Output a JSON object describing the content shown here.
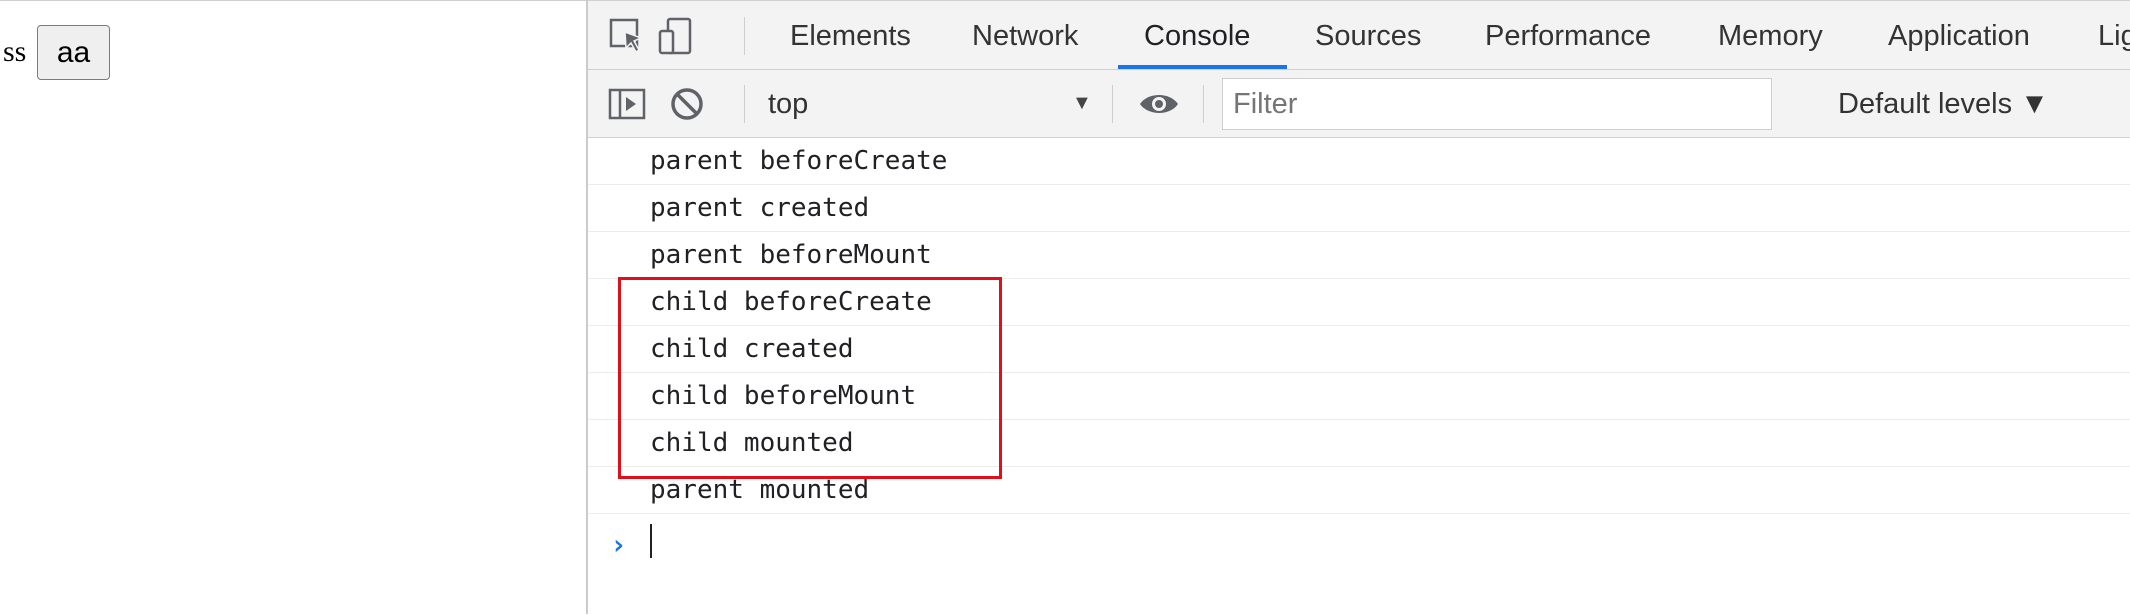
{
  "page": {
    "text": "ss",
    "button_label": "aa"
  },
  "devtools": {
    "tabs": [
      "Elements",
      "Network",
      "Console",
      "Sources",
      "Performance",
      "Memory",
      "Application",
      "Lig"
    ],
    "active_tab": "Console",
    "toolbar": {
      "context": "top",
      "filter_placeholder": "Filter",
      "levels_label": "Default levels ▼"
    },
    "console": {
      "logs": [
        "parent beforeCreate",
        "parent created",
        "parent beforeMount",
        "child beforeCreate",
        "child created",
        "child beforeMount",
        "child mounted",
        "parent mounted"
      ],
      "prompt": "›"
    },
    "colors": {
      "accent": "#1a73e8",
      "highlight": "#e0101a"
    }
  }
}
